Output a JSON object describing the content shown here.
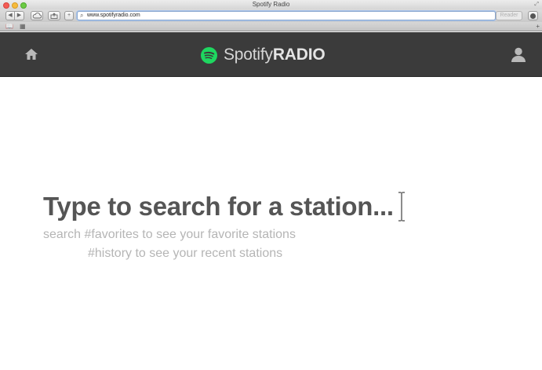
{
  "browser": {
    "window_title": "Spotify Radio",
    "url": "www.spotifyradio.com",
    "reader_label": "Reader"
  },
  "app": {
    "brand_light": "Spotify",
    "brand_bold": "RADIO",
    "brand_green": "#1ed760",
    "header_bg": "#3b3b3b"
  },
  "search": {
    "prompt": "Type to search for a station...",
    "hint_line_1": "search #favorites to see your favorite stations",
    "hint_line_2": "#history to see your recent stations"
  },
  "icons": [
    "home-icon",
    "spotify-logo-icon",
    "user-icon",
    "text-cursor-icon"
  ]
}
